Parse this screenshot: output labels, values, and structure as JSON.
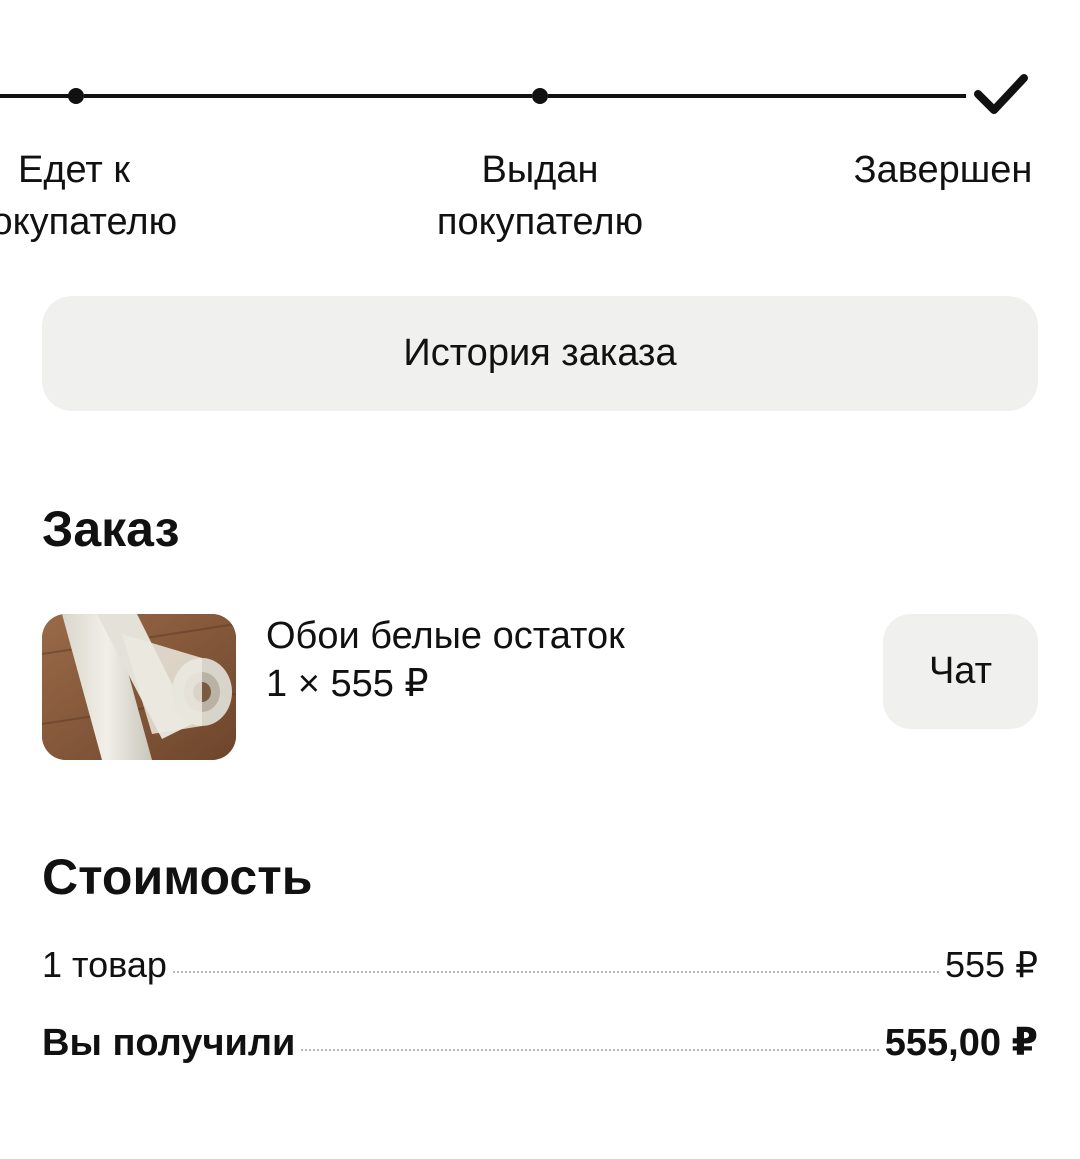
{
  "progress": {
    "steps": [
      {
        "label": "Едет к\nпокупателю"
      },
      {
        "label": "Выдан\nпокупателю"
      },
      {
        "label": "Завершен"
      }
    ]
  },
  "history_button": {
    "label": "История заказа"
  },
  "order": {
    "title": "Заказ",
    "item": {
      "name": "Обои белые остаток",
      "qty_price": "1 × 555 ₽"
    },
    "chat_label": "Чат"
  },
  "cost": {
    "title": "Стоимость",
    "rows": [
      {
        "label": "1 товар",
        "value": "555 ₽"
      },
      {
        "label": "Вы получили",
        "value": "555,00 ₽"
      }
    ]
  },
  "colors": {
    "button_bg": "#f0f0ef",
    "text": "#111111"
  },
  "icons": {
    "completed": "check-icon"
  }
}
